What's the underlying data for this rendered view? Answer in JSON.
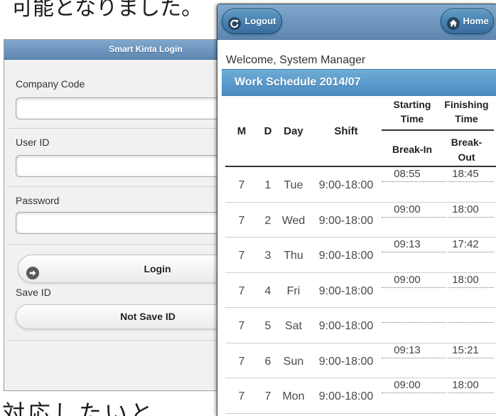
{
  "page_text": {
    "top_line": "可能となりました。",
    "bottom_line": "対応したいと"
  },
  "login_screen": {
    "title": "Smart Kinta Login",
    "company_code": {
      "label": "Company Code",
      "value": ""
    },
    "user_id": {
      "label": "User ID",
      "value": ""
    },
    "password": {
      "label": "Password",
      "value": ""
    },
    "login_button": {
      "label": "Login",
      "icon": "arrow-right-icon"
    },
    "save_id": {
      "label": "Save ID",
      "selected": "Not Save ID"
    }
  },
  "schedule_screen": {
    "toolbar": {
      "logout": {
        "label": "Logout",
        "icon": "back-icon"
      },
      "home": {
        "label": "Home",
        "icon": "home-icon"
      }
    },
    "welcome": "Welcome, System Manager",
    "title": "Work Schedule 2014/07",
    "columns": {
      "month": "M",
      "date": "D",
      "weekday": "Day",
      "shift": "Shift",
      "starting_time": "Starting Time",
      "finishing_time": "Finishing Time",
      "break_in": "Break-In",
      "break_out": "Break-Out"
    },
    "rows": [
      {
        "m": "7",
        "d": "1",
        "day": "Tue",
        "shift": "9:00-18:00",
        "start": "08:55",
        "finish": "18:45"
      },
      {
        "m": "7",
        "d": "2",
        "day": "Wed",
        "shift": "9:00-18:00",
        "start": "09:00",
        "finish": "18:00"
      },
      {
        "m": "7",
        "d": "3",
        "day": "Thu",
        "shift": "9:00-18:00",
        "start": "09:13",
        "finish": "17:42"
      },
      {
        "m": "7",
        "d": "4",
        "day": "Fri",
        "shift": "9:00-18:00",
        "start": "09:00",
        "finish": "18:00"
      },
      {
        "m": "7",
        "d": "5",
        "day": "Sat",
        "shift": "9:00-18:00",
        "start": "",
        "finish": ""
      },
      {
        "m": "7",
        "d": "6",
        "day": "Sun",
        "shift": "9:00-18:00",
        "start": "09:13",
        "finish": "15:21"
      },
      {
        "m": "7",
        "d": "7",
        "day": "Mon",
        "shift": "9:00-18:00",
        "start": "09:00",
        "finish": "18:00"
      }
    ]
  },
  "colors": {
    "header_gradient_top": "#81a8ce",
    "header_gradient_bottom": "#5e87b0",
    "header_button_top": "#5f9cc5",
    "header_button_bottom": "#396b9e",
    "title_bar": "#4a8bc2",
    "login_panel_background": "#f1f1f1"
  }
}
